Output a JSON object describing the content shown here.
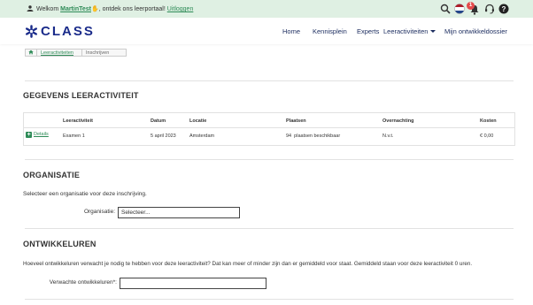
{
  "topbar": {
    "greeting_prefix": "Welkom ",
    "username": "MartinTest",
    "greeting_suffix": ", ontdek ons leerportaal!",
    "logout": "Uitloggen",
    "notification_count": "1"
  },
  "header": {
    "logo_text": "CLASS",
    "nav": [
      "Home",
      "Kennisplein",
      "Experts",
      "Leeractiviteiten",
      "Mijn ontwikkeldossier"
    ]
  },
  "breadcrumb": [
    "Leeractiviteiten",
    "Inschrijven"
  ],
  "gegevens": {
    "title": "GEGEVENS LEERACTIVITEIT",
    "columns": [
      "Leeractiviteit",
      "Datum",
      "Locatie",
      "Plaatsen",
      "Overnachting",
      "Kosten"
    ],
    "row": {
      "details": "Details",
      "leeractiviteit": "Examen 1",
      "datum": "5 april 2023",
      "locatie": "Amsterdam",
      "plaatsen": "94  plaatsen beschikbaar",
      "overnachting": "N.v.t.",
      "kosten": "€ 0,00"
    }
  },
  "organisatie": {
    "title": "ORGANISATIE",
    "description": "Selecteer een organisatie voor deze inschrijving.",
    "label": "Organisatie:",
    "placeholder": "Selecteer..."
  },
  "ontwikkeluren": {
    "title": "ONTWIKKELUREN",
    "description": "Hoeveel ontwikkeluren verwacht je nodig te hebben voor deze leeractiviteit? Dat kan meer of minder zijn dan er gemiddeld voor staat. Gemiddeld staan voor deze leeractiviteit 0 uren.",
    "label": "Verwachte ontwikkeluren*:",
    "value": ""
  },
  "colors": {
    "brand_blue": "#1a2b8a",
    "accent_green": "#2e8b57",
    "topbar_bg": "#dff0e3",
    "badge_red": "#e44b4b"
  },
  "icons": [
    "user-icon",
    "wave-emoji-icon",
    "search-icon",
    "dutch-flag-icon",
    "bell-icon",
    "support-headset-icon",
    "help-icon",
    "home-icon",
    "plus-icon",
    "logo-mark-icon",
    "chevron-down-icon"
  ]
}
